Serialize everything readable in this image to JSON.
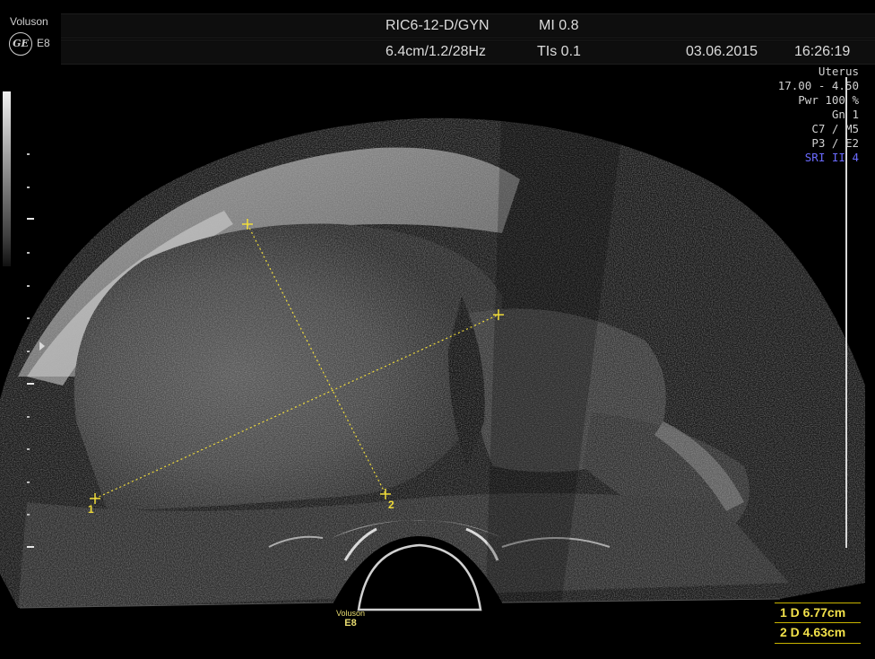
{
  "device": {
    "brand": "Voluson",
    "model": "E8",
    "logo_icon": "ge-logo-icon"
  },
  "header": {
    "probe": "RIC6-12-D/GYN",
    "mi": "MI 0.8",
    "depth_freq": "6.4cm/1.2/28Hz",
    "tis": "TIs 0.1",
    "date": "03.06.2015",
    "time": "16:26:19"
  },
  "params": {
    "preset": "Uterus",
    "range": "17.00 - 4.50",
    "power": "Pwr 100 %",
    "gain": "Gn  1",
    "c_m": "C7 / M5",
    "p_e": "P3 / E2",
    "sri": "SRI II 4"
  },
  "measurements": [
    {
      "index": "1",
      "label": "1  D 6.77cm",
      "value_cm": 6.77
    },
    {
      "index": "2",
      "label": "2  D 4.63cm",
      "value_cm": 4.63
    }
  ],
  "markers": {
    "m1": "1",
    "m2": "2"
  },
  "footer": {
    "brand": "Voluson",
    "model": "E8"
  },
  "colors": {
    "caliper": "#f0dc3a",
    "sri_text": "#6a6aff",
    "background": "#000000"
  }
}
